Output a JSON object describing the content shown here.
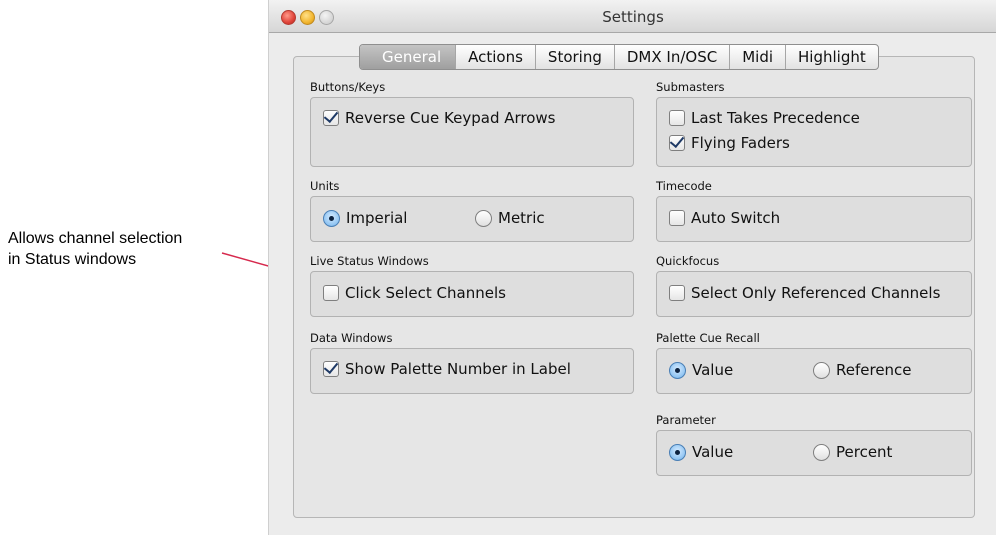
{
  "annotation": {
    "line1": "Allows channel selection",
    "line2": "in Status windows"
  },
  "window": {
    "title": "Settings"
  },
  "tabs": [
    "General",
    "Actions",
    "Storing",
    "DMX In/OSC",
    "Midi",
    "Highlight"
  ],
  "active_tab": "General",
  "groups": {
    "buttons_keys": {
      "label": "Buttons/Keys",
      "reverse_cue": {
        "label": "Reverse Cue Keypad Arrows",
        "checked": true
      }
    },
    "submasters": {
      "label": "Submasters",
      "last_takes": {
        "label": "Last Takes Precedence",
        "checked": false
      },
      "flying_faders": {
        "label": "Flying Faders",
        "checked": true
      }
    },
    "units": {
      "label": "Units",
      "imperial": "Imperial",
      "metric": "Metric",
      "selected": "Imperial"
    },
    "timecode": {
      "label": "Timecode",
      "auto_switch": {
        "label": "Auto Switch",
        "checked": false
      }
    },
    "live_status": {
      "label": "Live Status Windows",
      "click_select": {
        "label": "Click Select Channels",
        "checked": false
      }
    },
    "quickfocus": {
      "label": "Quickfocus",
      "select_only": {
        "label": "Select Only Referenced Channels",
        "checked": false
      }
    },
    "data_windows": {
      "label": "Data Windows",
      "show_palette": {
        "label": "Show Palette Number in Label",
        "checked": true
      }
    },
    "palette_cue_recall": {
      "label": "Palette Cue Recall",
      "value": "Value",
      "reference": "Reference",
      "selected": "Value"
    },
    "parameter": {
      "label": "Parameter",
      "value": "Value",
      "percent": "Percent",
      "selected": "Value"
    }
  },
  "colors": {
    "callout_arrow": "#d6294d",
    "active_tab": "#a8a8a8"
  }
}
